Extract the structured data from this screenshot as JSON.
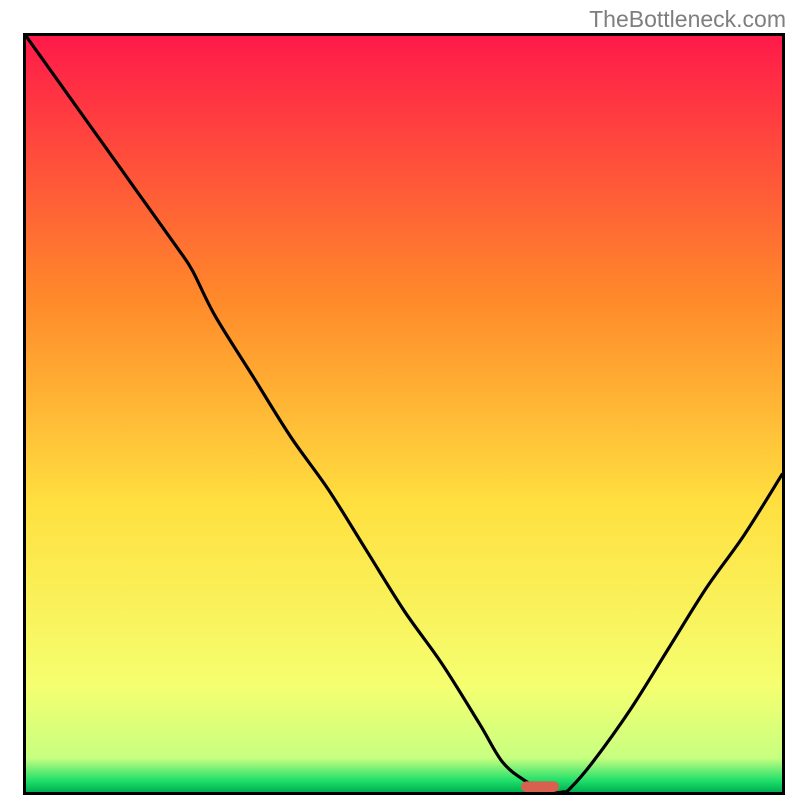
{
  "watermark": "TheBottleneck.com",
  "colors": {
    "top": "#ff1a4a",
    "mid1": "#ff8a2a",
    "mid2": "#ffe040",
    "mid3": "#f5ff70",
    "green": "#1fdf6a",
    "deepgreen": "#00b050",
    "border": "#000000",
    "curve": "#000000",
    "marker": "#d9604f"
  },
  "chart_data": {
    "type": "line",
    "title": "",
    "xlabel": "",
    "ylabel": "",
    "xlim": [
      0,
      100
    ],
    "ylim": [
      0,
      100
    ],
    "x": [
      0,
      5,
      10,
      15,
      20,
      22,
      25,
      30,
      35,
      40,
      45,
      50,
      55,
      60,
      63,
      66,
      69,
      71,
      72,
      75,
      80,
      85,
      90,
      95,
      100
    ],
    "values": [
      100,
      93,
      86,
      79,
      72,
      69,
      63,
      55,
      47,
      40,
      32,
      24,
      17,
      9,
      4,
      1.5,
      0,
      0,
      0.5,
      4,
      11,
      19,
      27,
      34,
      42
    ],
    "marker": {
      "x": 68,
      "y": 0.7,
      "w": 5,
      "h": 1.4
    }
  }
}
